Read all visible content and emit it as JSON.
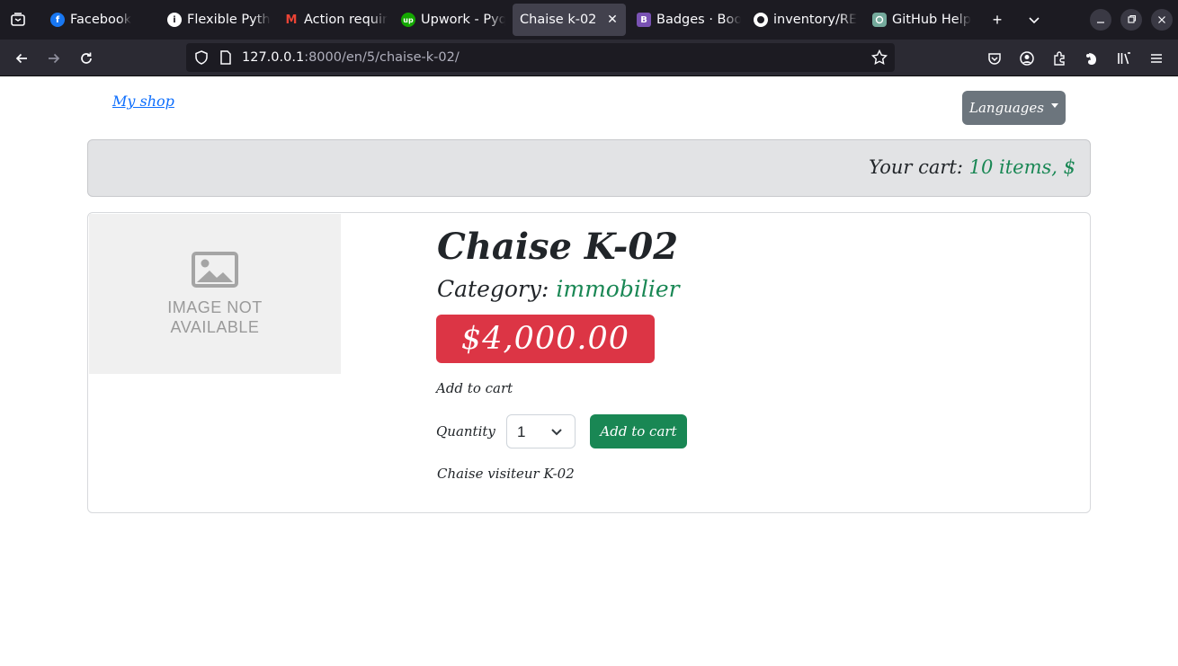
{
  "browser": {
    "tabs": [
      {
        "title": "Facebook",
        "icon": "facebook-icon",
        "color": "#1877f2"
      },
      {
        "title": "Flexible Pyth",
        "icon": "info-icon",
        "color": "#ffffff"
      },
      {
        "title": "Action requir",
        "icon": "gmail-icon",
        "color": "#ea4335"
      },
      {
        "title": "Upwork - Pyq",
        "icon": "upwork-icon",
        "color": "#14a800"
      },
      {
        "title": "Chaise k-02",
        "icon": "",
        "color": "",
        "active": true
      },
      {
        "title": "Badges · Boo",
        "icon": "bootstrap-icon",
        "color": "#7952b3"
      },
      {
        "title": "inventory/RE",
        "icon": "github-icon",
        "color": "#ffffff"
      },
      {
        "title": "GitHub Help",
        "icon": "openai-icon",
        "color": "#74aa9c"
      }
    ],
    "url_host": "127.0.0.1",
    "url_rest": ":8000/en/5/chaise-k-02/"
  },
  "page": {
    "brand": "My shop",
    "languages_label": "Languages",
    "cart_prefix": "Your cart:",
    "cart_link": "10 items, $",
    "image_placeholder": "IMAGE NOT AVAILABLE",
    "product_title": "Chaise K-02",
    "category_prefix": "Category:",
    "category_name": "immobilier",
    "price": "$4,000.00",
    "add_to_cart_heading": "Add to cart",
    "quantity_label": "Quantity",
    "quantity_value": "1",
    "add_to_cart_button": "Add to cart",
    "description": "Chaise visiteur K-02"
  },
  "colors": {
    "primary": "#0d6efd",
    "success": "#198754",
    "danger": "#dc3545",
    "secondary": "#6c757d"
  }
}
